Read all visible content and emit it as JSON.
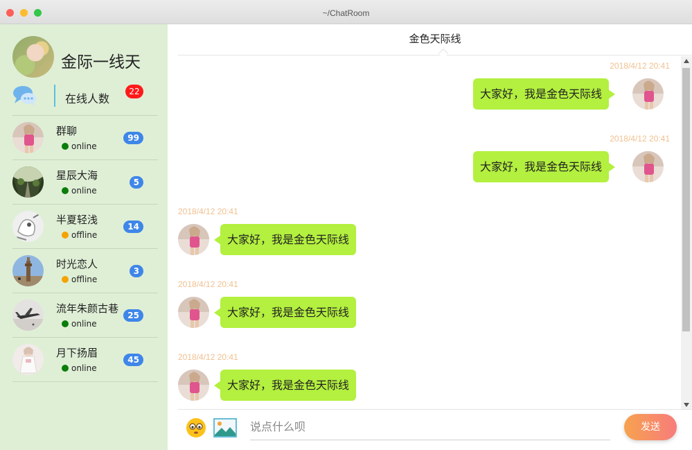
{
  "window": {
    "title": "~/ChatRoom"
  },
  "sidebar": {
    "me": {
      "name": "金际一线天"
    },
    "online": {
      "label": "在线人数",
      "count": "22"
    },
    "contacts": [
      {
        "name": "群聊",
        "status": "online",
        "badge": "99",
        "avatar": "girl-pink"
      },
      {
        "name": "星辰大海",
        "status": "online",
        "badge": "5",
        "avatar": "forest"
      },
      {
        "name": "半夏轻浅",
        "status": "offline",
        "badge": "14",
        "avatar": "white-doodle"
      },
      {
        "name": "时光恋人",
        "status": "offline",
        "badge": "3",
        "avatar": "tower"
      },
      {
        "name": "流年朱颜古巷",
        "status": "online",
        "badge": "25",
        "avatar": "airplane"
      },
      {
        "name": "月下扬眉",
        "status": "online",
        "badge": "45",
        "avatar": "girl-white"
      }
    ]
  },
  "chat": {
    "title": "金色天际线",
    "messages": [
      {
        "side": "right",
        "time": "2018/4/12 20:41",
        "text": "大家好，我是金色天际线"
      },
      {
        "side": "right",
        "time": "2018/4/12 20:41",
        "text": "大家好，我是金色天际线"
      },
      {
        "side": "left",
        "time": "2018/4/12 20:41",
        "text": "大家好，我是金色天际线"
      },
      {
        "side": "left",
        "time": "2018/4/12 20:41",
        "text": "大家好，我是金色天际线"
      },
      {
        "side": "left",
        "time": "2018/4/12 20:41",
        "text": "大家好，我是金色天际线"
      }
    ],
    "input": {
      "placeholder": "说点什么呗",
      "value": ""
    },
    "send_label": "发送",
    "emoji_icon": "emoji-face-icon",
    "image_icon": "image-landscape-icon"
  },
  "colors": {
    "sidebar_bg": "#dfefd6",
    "bubble": "#b3f03f",
    "badge_blue": "#3e86e8",
    "badge_red": "#ff1a1a",
    "timestamp": "#f0c090",
    "status_online": "#0a7d0a",
    "status_offline": "#f4a300"
  }
}
